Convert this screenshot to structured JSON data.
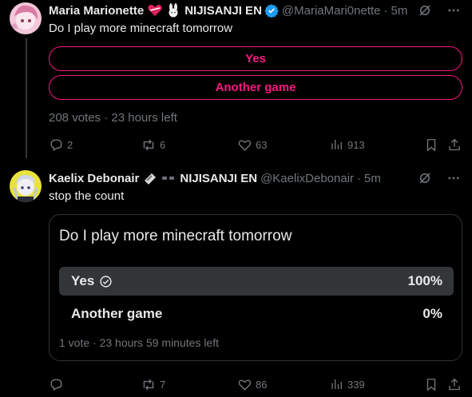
{
  "tweet1": {
    "name": "Maria Marionette",
    "org": "NIJISANJI EN",
    "handle": "@MariaMari0nette",
    "time": "5m",
    "text": "Do I play more minecraft tomorrow",
    "poll_options": [
      "Yes",
      "Another game"
    ],
    "poll_meta": "208 votes · 23 hours left",
    "replies": "2",
    "reposts": "6",
    "likes": "63",
    "views": "913",
    "accent": "#f91880"
  },
  "tweet2": {
    "name": "Kaelix Debonair",
    "org": "NIJISANJI EN",
    "handle": "@KaelixDebonair",
    "time": "5m",
    "text": "stop the count",
    "quote": {
      "question": "Do I play more minecraft tomorrow",
      "options": [
        {
          "label": "Yes",
          "percent": "100%",
          "share": 1.0,
          "selected": true
        },
        {
          "label": "Another game",
          "percent": "0%",
          "share": 0.0,
          "selected": false
        }
      ],
      "meta": "1 vote · 23 hours 59 minutes left"
    },
    "replies": "",
    "reposts": "7",
    "likes": "86",
    "views": "339"
  },
  "colors": {
    "background": "#000000",
    "text": "#e7e9ea",
    "muted": "#71767b",
    "verified": "#1d9bf0",
    "poll_fill": "#333639"
  },
  "icons": {
    "grok": "grok-icon",
    "more": "more-icon",
    "reply": "reply-icon",
    "repost": "repost-icon",
    "like": "heart-icon",
    "views": "views-icon",
    "bookmark": "bookmark-icon",
    "share": "share-icon"
  }
}
